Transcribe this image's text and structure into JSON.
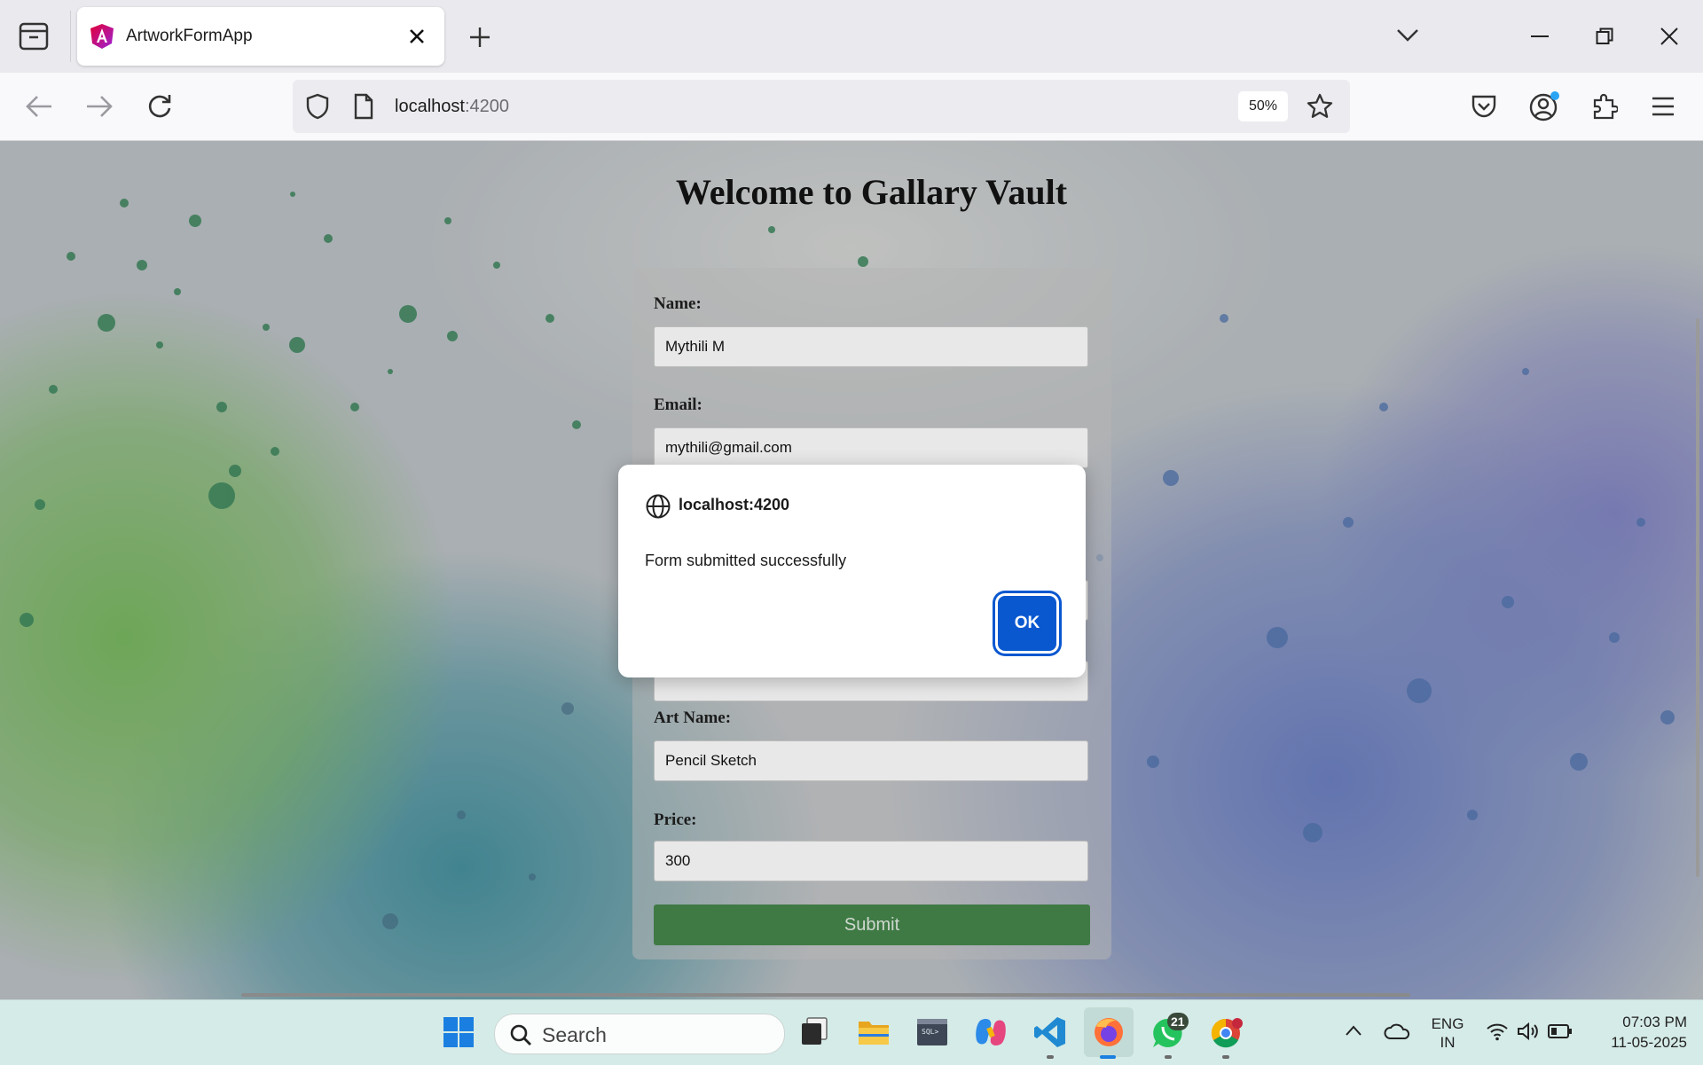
{
  "browser": {
    "tab_title": "ArtworkFormApp",
    "url_host": "localhost",
    "url_port": ":4200",
    "zoom": "50%"
  },
  "page": {
    "title": "Welcome to Gallary Vault",
    "form": {
      "name_label": "Name:",
      "name_value": "Mythili M",
      "email_label": "Email:",
      "email_value": "mythili@gmail.com",
      "art_name_label": "Art Name:",
      "art_name_value": "Pencil Sketch",
      "price_label": "Price:",
      "price_value": "300",
      "submit_label": "Submit"
    }
  },
  "dialog": {
    "origin": "localhost:4200",
    "message": "Form submitted successfully",
    "ok_label": "OK"
  },
  "taskbar": {
    "search_placeholder": "Search",
    "whatsapp_badge": "21",
    "language_line1": "ENG",
    "language_line2": "IN",
    "time": "07:03 PM",
    "date": "11-05-2025"
  },
  "colors": {
    "accent_blue": "#0a58d0",
    "submit_green": "#3f7a45",
    "taskbar_bg": "#d5ebe7"
  }
}
